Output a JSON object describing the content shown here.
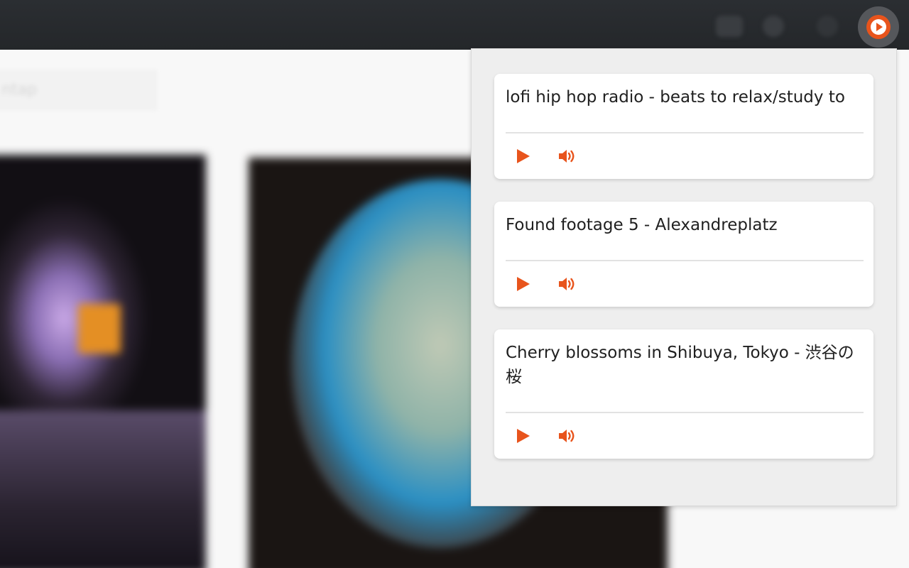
{
  "colors": {
    "accent": "#e8541c",
    "toolbar": "#26292c",
    "popup_bg": "#eeeeee",
    "card_bg": "#ffffff",
    "title_text": "#202020"
  },
  "background": {
    "search_text": "ntap"
  },
  "toolbar": {
    "extension_icon": "play-circle-icon"
  },
  "popup": {
    "streams": [
      {
        "title": "lofi hip hop radio - beats to relax/study to",
        "play_icon": "play-icon",
        "volume_icon": "volume-icon"
      },
      {
        "title": "Found footage 5 - Alexandreplatz",
        "play_icon": "play-icon",
        "volume_icon": "volume-icon"
      },
      {
        "title": "Cherry blossoms in Shibuya, Tokyo - 渋谷の桜",
        "play_icon": "play-icon",
        "volume_icon": "volume-icon"
      }
    ]
  }
}
